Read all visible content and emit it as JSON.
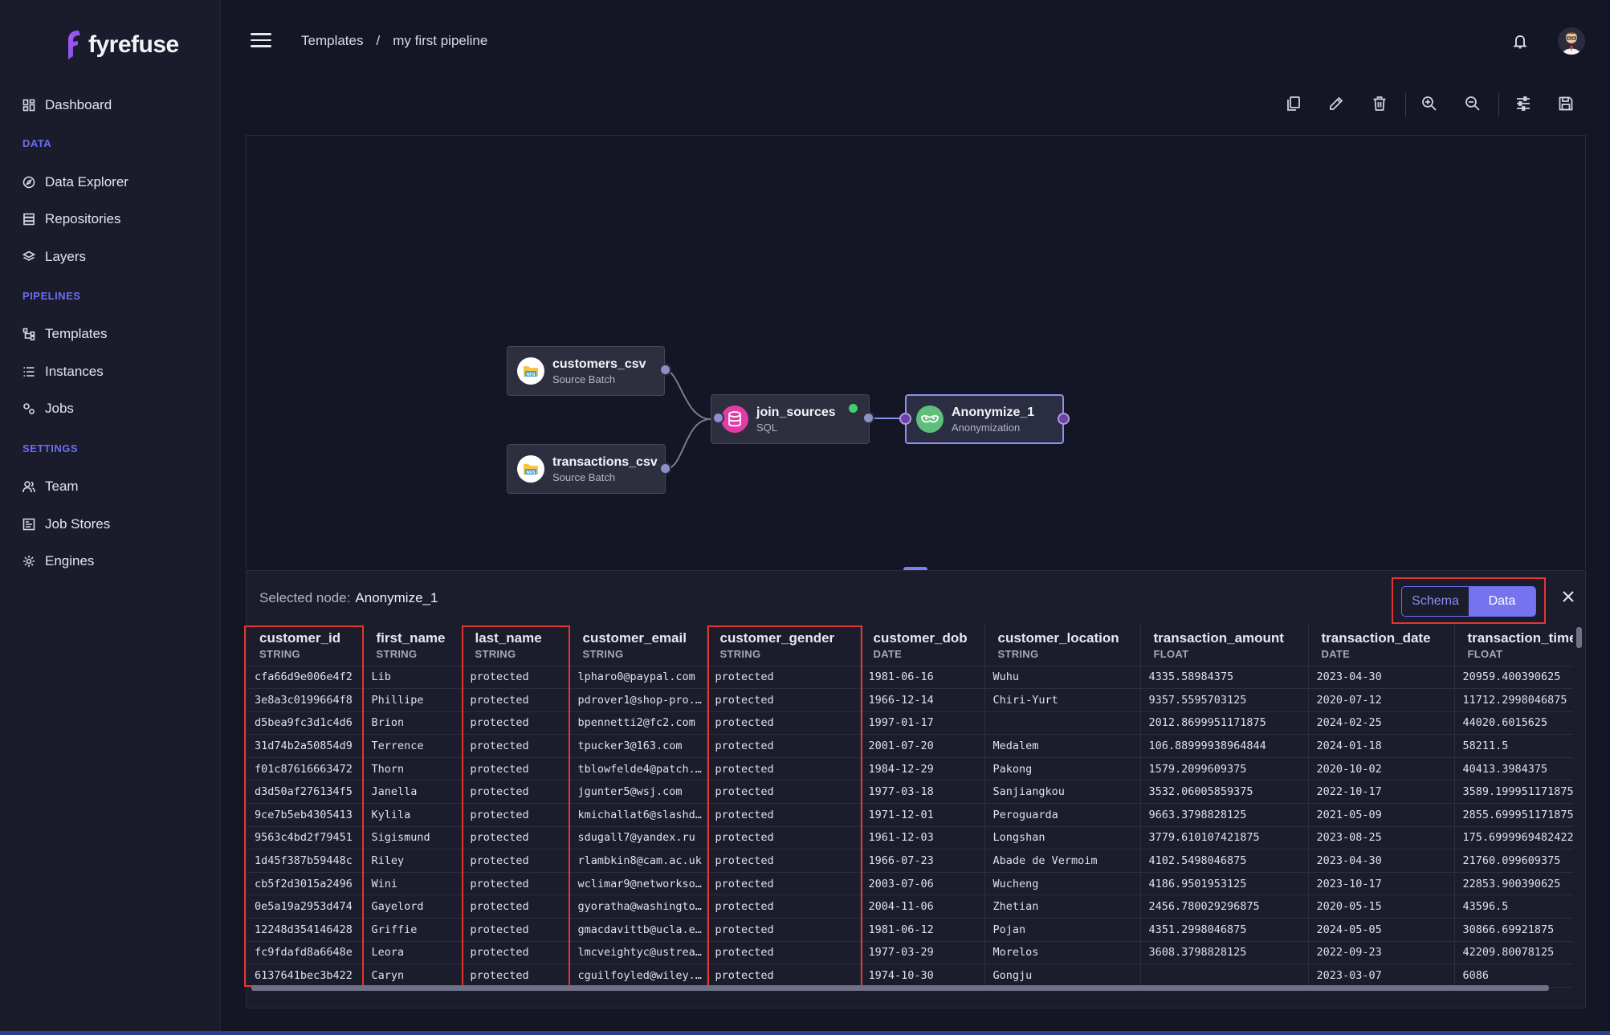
{
  "app": {
    "logo_text": "fyrefuse",
    "accent": "#6c6cf2"
  },
  "sidebar": {
    "dashboard": "Dashboard",
    "section_data": "DATA",
    "data_explorer": "Data Explorer",
    "repositories": "Repositories",
    "layers": "Layers",
    "section_pipelines": "PIPELINES",
    "templates": "Templates",
    "instances": "Instances",
    "jobs": "Jobs",
    "section_settings": "SETTINGS",
    "team": "Team",
    "job_stores": "Job Stores",
    "engines": "Engines"
  },
  "header": {
    "breadcrumb_root": "Templates",
    "breadcrumb_sep": "/",
    "breadcrumb_current": "my first pipeline"
  },
  "toolbar": {
    "icons": [
      "copy-icon",
      "edit-icon",
      "trash-icon",
      "zoom-in-icon",
      "zoom-out-icon",
      "settings-sliders-icon",
      "save-icon"
    ]
  },
  "nodes": {
    "customers": {
      "title": "customers_csv",
      "subtitle": "Source Batch",
      "icon_label": "NFS"
    },
    "transactions": {
      "title": "transactions_csv",
      "subtitle": "Source Batch",
      "icon_label": "NFS"
    },
    "join": {
      "title": "join_sources",
      "subtitle": "SQL"
    },
    "anonymize": {
      "title": "Anonymize_1",
      "subtitle": "Anonymization"
    }
  },
  "panel": {
    "selected_label": "Selected node:",
    "selected_value": "Anonymize_1",
    "toggle_schema": "Schema",
    "toggle_data": "Data",
    "active_toggle": "Data"
  },
  "table": {
    "columns": [
      {
        "name": "customer_id",
        "type": "STRING"
      },
      {
        "name": "first_name",
        "type": "STRING"
      },
      {
        "name": "last_name",
        "type": "STRING"
      },
      {
        "name": "customer_email",
        "type": "STRING"
      },
      {
        "name": "customer_gender",
        "type": "STRING"
      },
      {
        "name": "customer_dob",
        "type": "DATE"
      },
      {
        "name": "customer_location",
        "type": "STRING"
      },
      {
        "name": "transaction_amount",
        "type": "FLOAT"
      },
      {
        "name": "transaction_date",
        "type": "DATE"
      },
      {
        "name": "transaction_time",
        "type": "FLOAT"
      }
    ],
    "rows": [
      [
        "cfa66d9e006e4f2",
        "Lib",
        "protected",
        "lpharo0@paypal.com",
        "protected",
        "1981-06-16",
        "Wuhu",
        "4335.58984375",
        "2023-04-30",
        "20959.400390625"
      ],
      [
        "3e8a3c0199664f8",
        "Phillipe",
        "protected",
        "pdrover1@shop-pro.…",
        "protected",
        "1966-12-14",
        "Chiri-Yurt",
        "9357.5595703125",
        "2020-07-12",
        "11712.2998046875"
      ],
      [
        "d5bea9fc3d1c4d6",
        "Brion",
        "protected",
        "bpennetti2@fc2.com",
        "protected",
        "1997-01-17",
        "",
        "2012.8699951171875",
        "2024-02-25",
        "44020.6015625"
      ],
      [
        "31d74b2a50854d9",
        "Terrence",
        "protected",
        "tpucker3@163.com",
        "protected",
        "2001-07-20",
        "Medalem",
        "106.88999938964844",
        "2024-01-18",
        "58211.5"
      ],
      [
        "f01c87616663472",
        "Thorn",
        "protected",
        "tblowfelde4@patch.…",
        "protected",
        "1984-12-29",
        "Pakong",
        "1579.2099609375",
        "2020-10-02",
        "40413.3984375"
      ],
      [
        "d3d50af276134f5",
        "Janella",
        "protected",
        "jgunter5@wsj.com",
        "protected",
        "1977-03-18",
        "Sanjiangkou",
        "3532.06005859375",
        "2022-10-17",
        "3589.199951171875"
      ],
      [
        "9ce7b5eb4305413",
        "Kylila",
        "protected",
        "kmichallat6@slashd…",
        "protected",
        "1971-12-01",
        "Peroguarda",
        "9663.3798828125",
        "2021-05-09",
        "2855.699951171875"
      ],
      [
        "9563c4bd2f79451",
        "Sigismund",
        "protected",
        "sdugall7@yandex.ru",
        "protected",
        "1961-12-03",
        "Longshan",
        "3779.610107421875",
        "2023-08-25",
        "175.6999969482422"
      ],
      [
        "1d45f387b59448c",
        "Riley",
        "protected",
        "rlambkin8@cam.ac.uk",
        "protected",
        "1966-07-23",
        "Abade de Vermoim",
        "4102.5498046875",
        "2023-04-30",
        "21760.099609375"
      ],
      [
        "cb5f2d3015a2496",
        "Wini",
        "protected",
        "wclimar9@networkso…",
        "protected",
        "2003-07-06",
        "Wucheng",
        "4186.9501953125",
        "2023-10-17",
        "22853.900390625"
      ],
      [
        "0e5a19a2953d474",
        "Gayelord",
        "protected",
        "gyoratha@washingto…",
        "protected",
        "2004-11-06",
        "Zhetian",
        "2456.780029296875",
        "2020-05-15",
        "43596.5"
      ],
      [
        "12248d354146428",
        "Griffie",
        "protected",
        "gmacdavittb@ucla.e…",
        "protected",
        "1981-06-12",
        "Pojan",
        "4351.2998046875",
        "2024-05-05",
        "30866.69921875"
      ],
      [
        "fc9fdafd8a6648e",
        "Leora",
        "protected",
        "lmcveightyc@ustrea…",
        "protected",
        "1977-03-29",
        "Morelos",
        "3608.3798828125",
        "2022-09-23",
        "42209.80078125"
      ],
      [
        "6137641bec3b422",
        "Caryn",
        "protected",
        "cguilfoyled@wiley.…",
        "protected",
        "1974-10-30",
        "Gongju",
        "",
        "2023-03-07",
        "6086"
      ]
    ]
  }
}
